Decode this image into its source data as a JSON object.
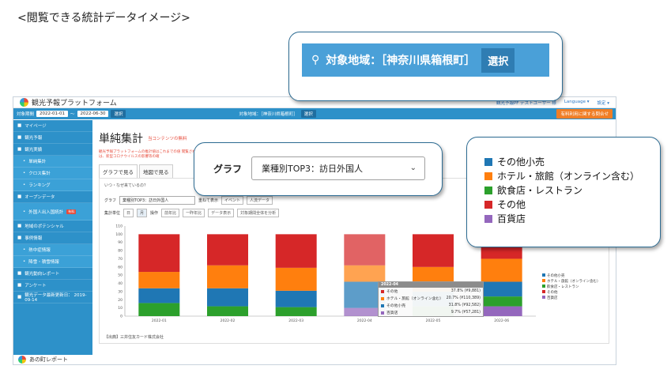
{
  "page_heading": "<閲覧できる統計データイメージ>",
  "app": {
    "logo_text": "観光予報プラットフォーム",
    "topbar_links": [
      "観光予報PF テストユーザー 様",
      "Language ▾",
      "設定 ▾"
    ],
    "period_label": "対象期間",
    "date_from": "2022-01-01",
    "date_tilde": "〜",
    "date_to": "2022-06-30",
    "select_label": "選択",
    "region_mini": "対象地域：［神奈川県箱根町］",
    "orange_button": "有料利用に関する問合せ"
  },
  "sidebar": {
    "items": [
      {
        "label": "マイページ",
        "sub": false
      },
      {
        "label": "観光予報",
        "sub": false
      },
      {
        "label": "観光実績",
        "sub": false
      },
      {
        "label": "単純集計",
        "sub": true
      },
      {
        "label": "クロス集計",
        "sub": true
      },
      {
        "label": "ランキング",
        "sub": true
      },
      {
        "label": "オープンデータ",
        "sub": false
      },
      {
        "label": "外国人出入国統計",
        "sub": true,
        "badge": "有料"
      },
      {
        "label": "地域のポテンシャル",
        "sub": false
      },
      {
        "label": "事例情報",
        "sub": false
      },
      {
        "label": "熱中症情報",
        "sub": true
      },
      {
        "label": "降雪・積雪情報",
        "sub": true
      },
      {
        "label": "観光動向レポート",
        "sub": false
      },
      {
        "label": "アンケート",
        "sub": false
      },
      {
        "label": "観光データ最新更新日： 2019-09-14",
        "sub": false
      }
    ],
    "footer": "あの町レポート"
  },
  "main": {
    "title": "単純集計",
    "notice": "当コンテンツの無料",
    "notice_text": "観光予報プラットフォームの推計値はこれまでの値 閲覧される際は、新型コロナウイルスの影響等の確",
    "tabs": [
      "グラフで見る",
      "地図で見る"
    ],
    "why": "いつ・なぜ来ているの？",
    "graph_label": "グラフ",
    "graph_value": "業種別TOP3：訪日外国人",
    "overlay_label": "重ねて表示",
    "event_btn": "イベント",
    "people_btn": "人流データ",
    "unit_label": "集計単位",
    "unit_day": "日",
    "unit_month": "月",
    "op_label": "操作",
    "prev_year": "前年比",
    "prev_period": "一昨年比",
    "data_btn": "データ表示",
    "analyze_btn": "対象期間全体を分析",
    "source": "【出典】三井住友カード株式会社"
  },
  "tooltip": {
    "title": "2022-04",
    "rows": [
      {
        "name": "その他",
        "value": "37.8% (¥9,881)",
        "color": "#d62728"
      },
      {
        "name": "ホテル・旅館（オンライン含む）",
        "value": "20.7% (¥110,389)",
        "color": "#ff7f0e"
      },
      {
        "name": "その他小売",
        "value": "31.8% (¥92,582)",
        "color": "#1f77b4"
      },
      {
        "name": "百貨店",
        "value": "9.7% (¥57,281)",
        "color": "#9467bd"
      }
    ]
  },
  "callouts": {
    "region_text": "対象地域：［神奈川県箱根町］",
    "region_select": "選択",
    "graph_label": "グラフ",
    "graph_value": "業種別TOP3：訪日外国人"
  },
  "chart_data": {
    "type": "bar",
    "stacked": true,
    "categories": [
      "2022-01",
      "2022-02",
      "2022-03",
      "2022-04",
      "2022-05",
      "2022-06"
    ],
    "ylim": [
      0,
      110
    ],
    "yticks": [
      0,
      10,
      20,
      30,
      40,
      50,
      60,
      70,
      80,
      90,
      100,
      110
    ],
    "highlight_index": 3,
    "series": [
      {
        "name": "その他小売",
        "color": "#1f77b4",
        "values": [
          0,
          0,
          0,
          32,
          0,
          0
        ]
      },
      {
        "name": "ホテル・旅館（オンライン含む）",
        "color": "#ff7f0e",
        "values": [
          20,
          28,
          28,
          20,
          30,
          28
        ]
      },
      {
        "name": "飲食店・レストラン",
        "color": "#2ca02c",
        "values": [
          16,
          12,
          11,
          0,
          12,
          12
        ]
      },
      {
        "name": "その他",
        "color": "#d62728",
        "values": [
          46,
          38,
          41,
          38,
          40,
          30
        ]
      },
      {
        "name": "百貨店",
        "color": "#9467bd",
        "values": [
          0,
          0,
          0,
          10,
          0,
          12
        ]
      }
    ],
    "extra_blue": [
      18,
      22,
      20,
      0,
      18,
      18
    ],
    "legend_small": [
      "その他小売",
      "ホテル・旅館（オンライン含む）",
      "飲食店・レストラン",
      "その他",
      "百貨店"
    ]
  }
}
